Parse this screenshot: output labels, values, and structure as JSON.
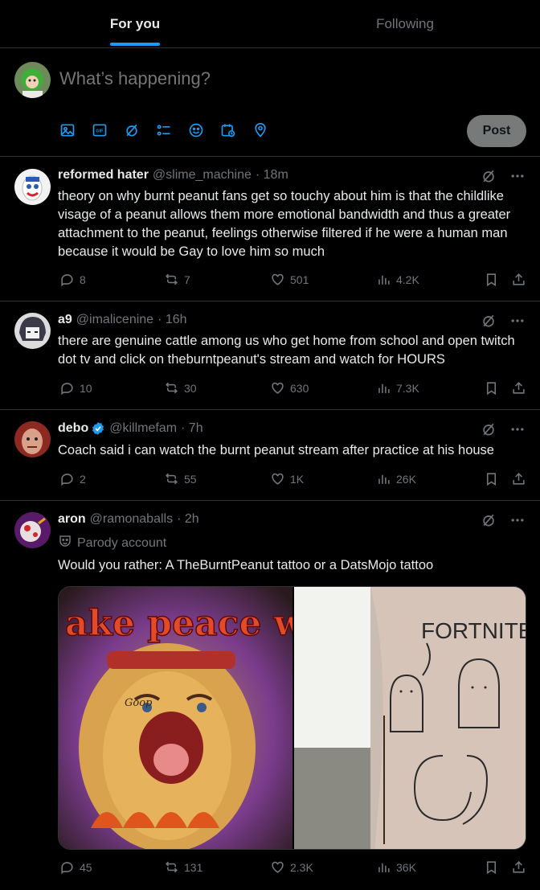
{
  "tabs": [
    {
      "label": "For you",
      "active": true
    },
    {
      "label": "Following",
      "active": false
    }
  ],
  "composer": {
    "placeholder": "What’s happening?",
    "post_label": "Post",
    "tools": [
      "media-icon",
      "gif-icon",
      "grok-icon",
      "poll-icon",
      "emoji-icon",
      "schedule-icon",
      "location-icon"
    ]
  },
  "colors": {
    "accent": "#1d9bf0",
    "text": "#e7e9ea",
    "muted": "#71767b",
    "border": "#2f3336"
  },
  "tweets": [
    {
      "name": "reformed hater",
      "handle": "@slime_machine",
      "time": "· 18m",
      "text": "theory on why burnt peanut fans get so touchy about him is that the childlike visage of a peanut allows them more emotional bandwidth and thus a greater attachment to the peanut, feelings otherwise filtered if he were a human man because it would be Gay to love him so much",
      "replies": "8",
      "reposts": "7",
      "likes": "501",
      "views": "4.2K"
    },
    {
      "name": "a9",
      "handle": "@imalicenine",
      "time": "· 16h",
      "text": "there are genuine cattle among us who get home from school and open twitch dot tv and click on theburntpeanut's stream and watch for HOURS",
      "replies": "10",
      "reposts": "30",
      "likes": "630",
      "views": "7.3K"
    },
    {
      "name": "debo",
      "handle": "@killmefam",
      "time": "· 7h",
      "text": "Coach said i can watch the burnt peanut stream after practice at his house",
      "replies": "2",
      "reposts": "55",
      "likes": "1K",
      "views": "26K"
    },
    {
      "name": "aron",
      "handle": "@ramonaballs",
      "time": "· 2h",
      "parody_label": "Parody account",
      "text": "Would you rather: A TheBurntPeanut tattoo or a DatsMojo tattoo",
      "media_text_left": "ake peace wit",
      "media_text_goop": "Goop",
      "media_text_right": "FORTNITE",
      "replies": "45",
      "reposts": "131",
      "likes": "2.3K",
      "views": "36K"
    }
  ]
}
